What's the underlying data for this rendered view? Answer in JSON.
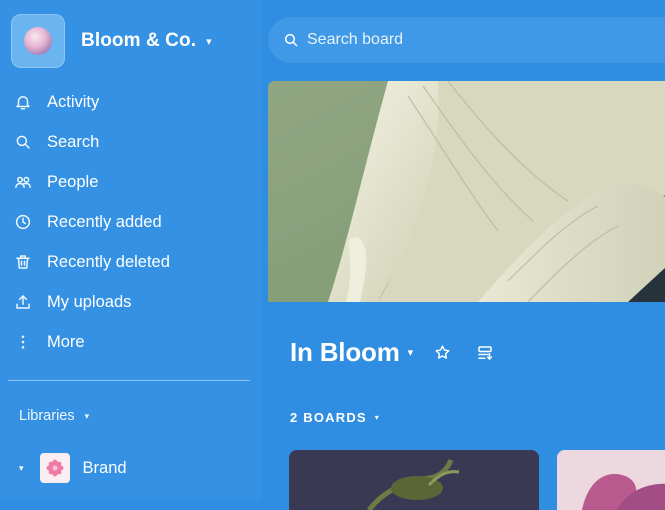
{
  "workspace": {
    "name": "Bloom & Co.",
    "caret": "▾"
  },
  "nav": {
    "items": [
      {
        "label": "Activity",
        "icon": "bell-icon"
      },
      {
        "label": "Search",
        "icon": "search-icon"
      },
      {
        "label": "People",
        "icon": "people-icon"
      },
      {
        "label": "Recently added",
        "icon": "clock-icon"
      },
      {
        "label": "Recently deleted",
        "icon": "trash-icon"
      },
      {
        "label": "My uploads",
        "icon": "upload-icon"
      },
      {
        "label": "More",
        "icon": "more-vertical-icon"
      }
    ]
  },
  "libraries": {
    "label": "Libraries",
    "caret": "▾"
  },
  "library_items": [
    {
      "label": "Brand",
      "caret": "▾"
    }
  ],
  "search": {
    "placeholder": "Search board"
  },
  "board": {
    "title": "In Bloom",
    "caret": "▾"
  },
  "boards": {
    "count_label": "2 BOARDS",
    "caret": "▾"
  },
  "colors": {
    "background": "#2f8ee2",
    "sidebar": "#3491e4",
    "search_bg": "#4099e6"
  }
}
